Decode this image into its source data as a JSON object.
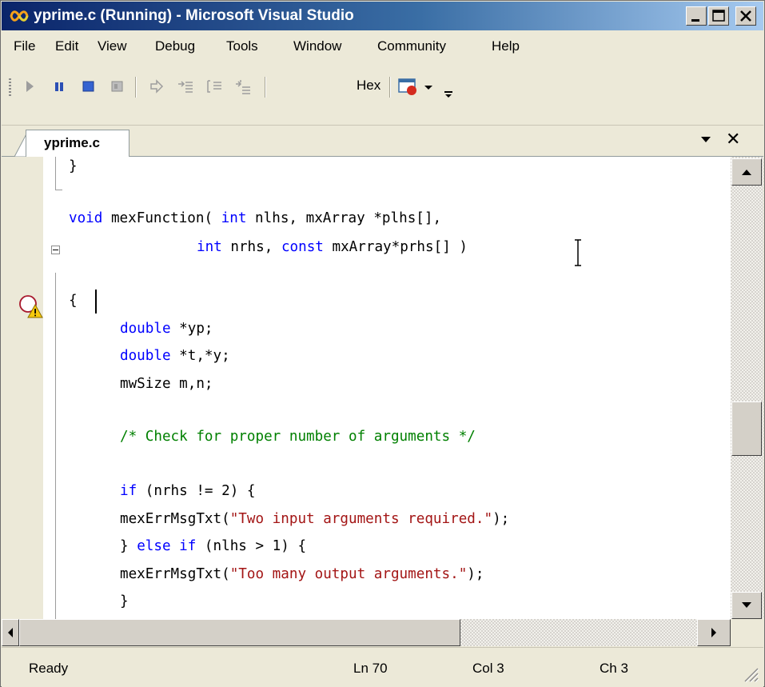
{
  "window": {
    "title": "yprime.c (Running) - Microsoft Visual Studio"
  },
  "menu": {
    "items": [
      "File",
      "Edit",
      "View",
      "Debug",
      "Tools",
      "Window",
      "Community",
      "Help"
    ]
  },
  "toolbar": {
    "hex_label": "Hex",
    "icons": [
      "continue-icon",
      "break-all-icon",
      "stop-debugging-icon",
      "restart-icon",
      "show-next-statement-icon",
      "step-into-icon",
      "step-over-icon",
      "step-out-icon",
      "breakpoints-window-icon"
    ]
  },
  "tab": {
    "label": "yprime.c"
  },
  "code": {
    "line1": "}",
    "line2_kw1": "void",
    "line2_a": " mexFunction( ",
    "line2_kw2": "int",
    "line2_b": " nlhs, mxArray *plhs[],",
    "line3_kw1": "int",
    "line3_a": " nrhs, ",
    "line3_kw2": "const",
    "line3_b": " mxArray*prhs[] )",
    "line4": "{",
    "line5_kw": "double",
    "line5_rest": " *yp;",
    "line6_kw": "double",
    "line6_rest": " *t,*y;",
    "line7": "mwSize m,n;",
    "line8": "/* Check for proper number of arguments */",
    "line9_kw": "if",
    "line9_rest": " (nrhs != 2) {",
    "line10_a": "mexErrMsgTxt(",
    "line10_str": "\"Two input arguments required.\"",
    "line10_b": ");",
    "line11_a": "} ",
    "line11_kw1": "else",
    "line11_sp": " ",
    "line11_kw2": "if",
    "line11_rest": " (nlhs > 1) {",
    "line12_a": "mexErrMsgTxt(",
    "line12_str": "\"Too many output arguments.\"",
    "line12_b": ");",
    "line13": "}"
  },
  "status": {
    "ready": "Ready",
    "line": "Ln 70",
    "col": "Col 3",
    "ch": "Ch 3"
  },
  "colors": {
    "keyword": "#0000ff",
    "comment": "#008000",
    "string": "#a31515",
    "titlebar_start": "#0a246a",
    "titlebar_end": "#a6caf0"
  }
}
